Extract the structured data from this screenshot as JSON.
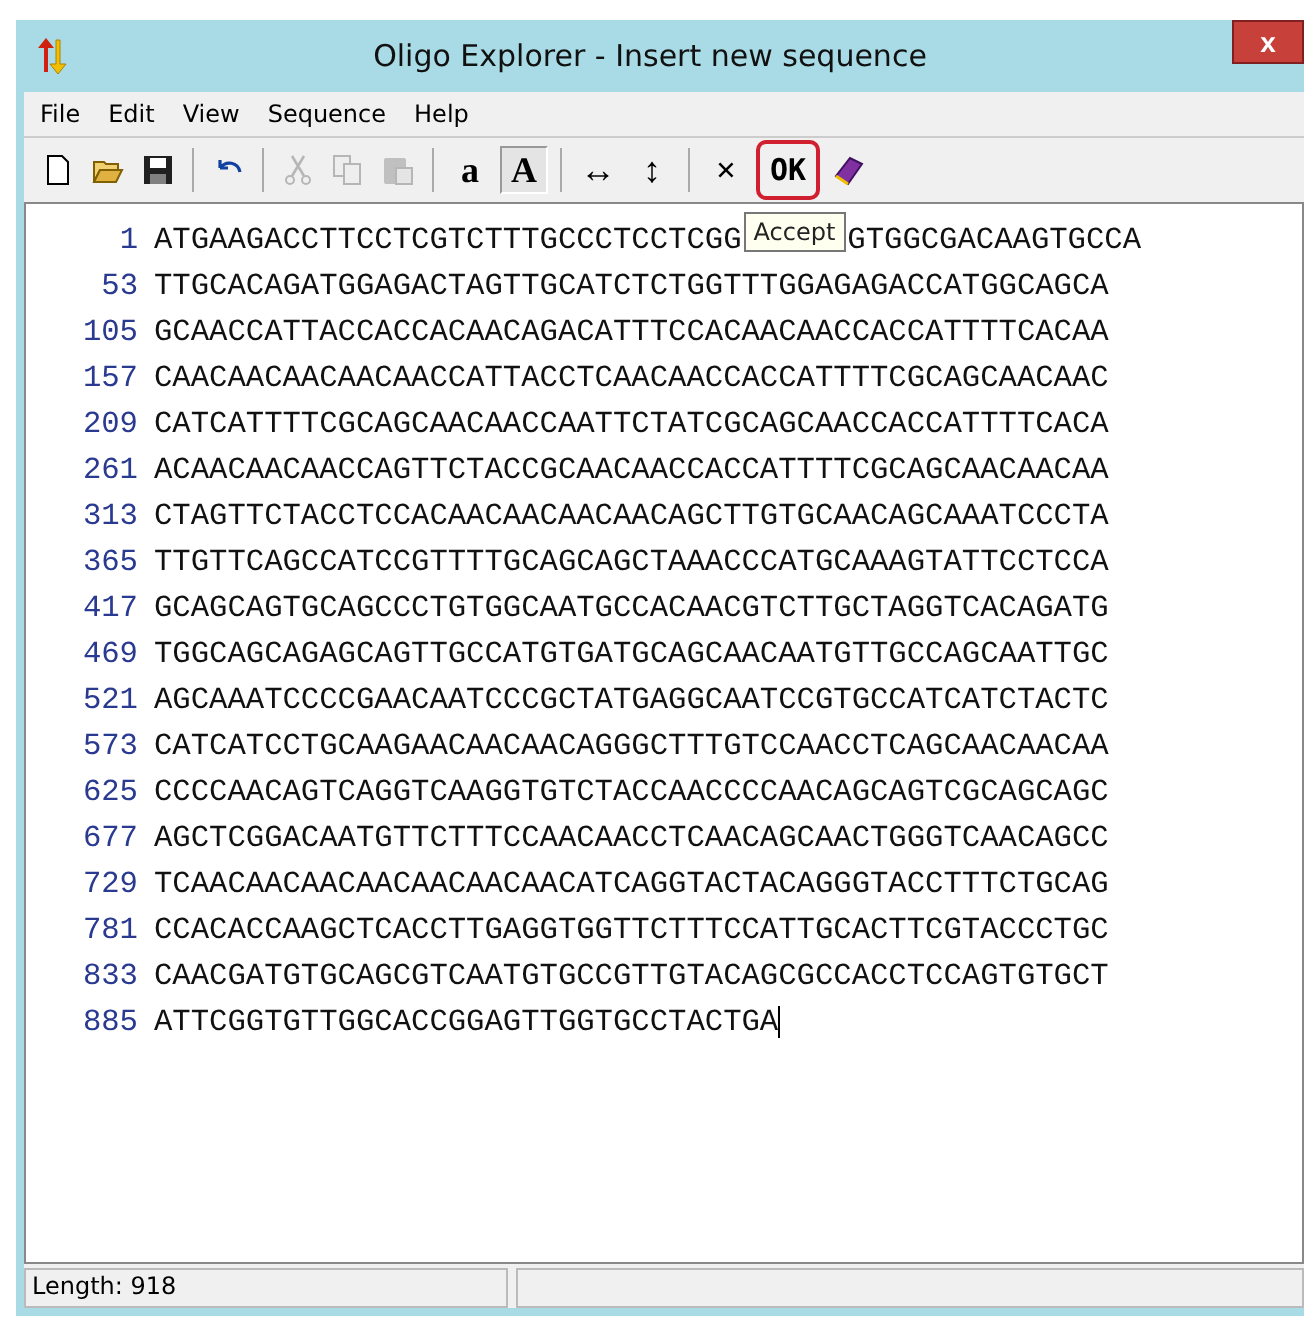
{
  "window": {
    "title": "Oligo Explorer - Insert new sequence",
    "close": "x"
  },
  "menu": [
    {
      "label": "File"
    },
    {
      "label": "Edit"
    },
    {
      "label": "View"
    },
    {
      "label": "Sequence"
    },
    {
      "label": "Help"
    }
  ],
  "toolbar": [
    {
      "kind": "new",
      "disabled": false
    },
    {
      "kind": "open",
      "disabled": false
    },
    {
      "kind": "save",
      "disabled": false
    },
    {
      "kind": "sep"
    },
    {
      "kind": "undo",
      "disabled": false
    },
    {
      "kind": "sep"
    },
    {
      "kind": "cut",
      "disabled": true
    },
    {
      "kind": "copy",
      "disabled": true
    },
    {
      "kind": "paste",
      "disabled": true
    },
    {
      "kind": "sep"
    },
    {
      "kind": "text",
      "label": "a",
      "pressed": false,
      "highlighted": false
    },
    {
      "kind": "text",
      "label": "A",
      "pressed": true,
      "highlighted": false
    },
    {
      "kind": "sep"
    },
    {
      "kind": "text",
      "label": "↔",
      "pressed": false,
      "highlighted": false
    },
    {
      "kind": "text",
      "label": "↕",
      "pressed": false,
      "highlighted": false
    },
    {
      "kind": "sep"
    },
    {
      "kind": "text",
      "label": "×",
      "pressed": false,
      "highlighted": false
    },
    {
      "kind": "text",
      "label": "OK",
      "pressed": false,
      "highlighted": true
    },
    {
      "kind": "book",
      "disabled": false
    }
  ],
  "tooltip": "Accept",
  "lines": [
    {
      "number": "1",
      "parts": [
        "ATGAAGACCTTCCTCGTCTTTGCCCTCCTCGG",
        "GTGGCGACAAGTGCCA"
      ]
    },
    {
      "number": "53",
      "parts": [
        "TTGCACAGATGGAGACTAGTTGCATCTCTGGTTTGGAGAGACCATGGCAGCA"
      ]
    },
    {
      "number": "105",
      "parts": [
        "GCAACCATTACCACCACAACAGACATTTCCACAACAACCACCATTTTCACAA"
      ]
    },
    {
      "number": "157",
      "parts": [
        "CAACAACAACAACAACCATTACCTCAACAACCACCATTTTCGCAGCAACAAC"
      ]
    },
    {
      "number": "209",
      "parts": [
        "CATCATTTTCGCAGCAACAACCAATTCTATCGCAGCAACCACCATTTTCACA"
      ]
    },
    {
      "number": "261",
      "parts": [
        "ACAACAACAACCAGTTCTACCGCAACAACCACCATTTTCGCAGCAACAACAA"
      ]
    },
    {
      "number": "313",
      "parts": [
        "CTAGTTCTACCTCCACAACAACAACAACAGCTTGTGCAACAGCAAATCCCTA"
      ]
    },
    {
      "number": "365",
      "parts": [
        "TTGTTCAGCCATCCGTTTTGCAGCAGCTAAACCCATGCAAAGTATTCCTCCA"
      ]
    },
    {
      "number": "417",
      "parts": [
        "GCAGCAGTGCAGCCCTGTGGCAATGCCACAACGTCTTGCTAGGTCACAGATG"
      ]
    },
    {
      "number": "469",
      "parts": [
        "TGGCAGCAGAGCAGTTGCCATGTGATGCAGCAACAATGTTGCCAGCAATTGC"
      ]
    },
    {
      "number": "521",
      "parts": [
        "AGCAAATCCCCGAACAATCCCGCTATGAGGCAATCCGTGCCATCATCTACTC"
      ]
    },
    {
      "number": "573",
      "parts": [
        "CATCATCCTGCAAGAACAACAACAGGGCTTTGTCCAACCTCAGCAACAACAA"
      ]
    },
    {
      "number": "625",
      "parts": [
        "CCCCAACAGTCAGGTCAAGGTGTCTACCAACCCCAACAGCAGTCGCAGCAGC"
      ]
    },
    {
      "number": "677",
      "parts": [
        "AGCTCGGACAATGTTCTTTCCAACAACCTCAACAGCAACTGGGTCAACAGCC"
      ]
    },
    {
      "number": "729",
      "parts": [
        "TCAACAACAACAACAACAACAACATCAGGTACTACAGGGTACCTTTCTGCAG"
      ]
    },
    {
      "number": "781",
      "parts": [
        "CCACACCAAGCTCACCTTGAGGTGGTTCTTTCCATTGCACTTCGTACCCTGC"
      ]
    },
    {
      "number": "833",
      "parts": [
        "CAACGATGTGCAGCGTCAATGTGCCGTTGTACAGCGCCACCTCCAGTGTGCT"
      ]
    },
    {
      "number": "885",
      "parts": [
        "ATTCGGTGTTGGCACCGGAGTTGGTGCCTACTGA"
      ],
      "cursor": true
    }
  ],
  "status_bar": {
    "length": "Length: 918"
  }
}
